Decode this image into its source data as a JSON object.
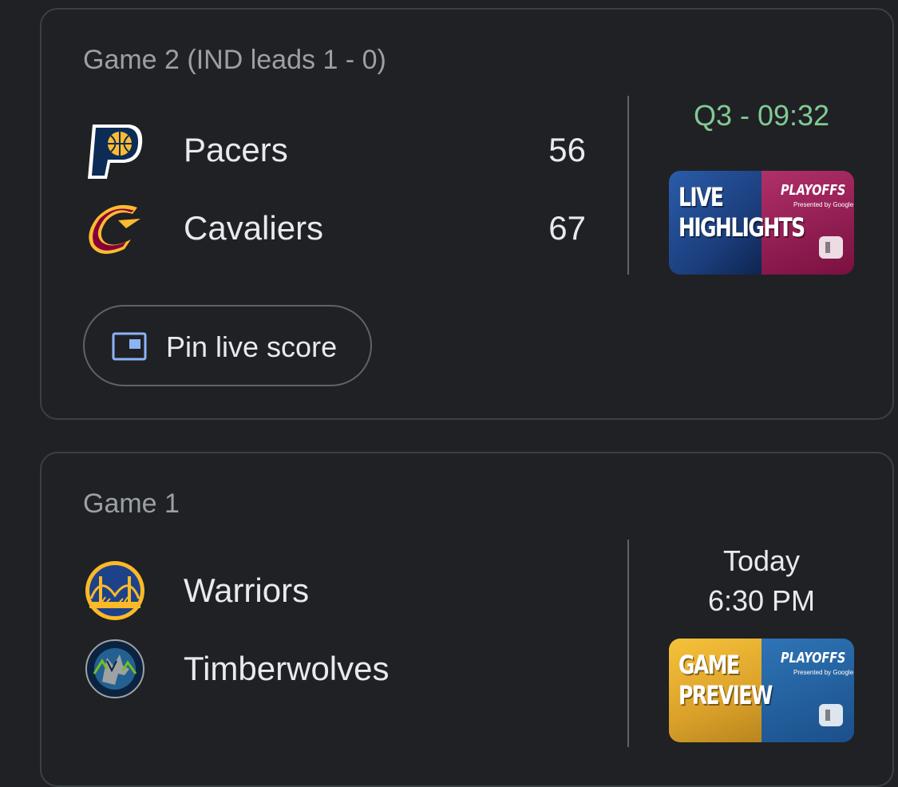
{
  "games": [
    {
      "title": "Game 2 (IND leads 1 - 0)",
      "teams": [
        {
          "name": "Pacers",
          "score": "56"
        },
        {
          "name": "Cavaliers",
          "score": "67"
        }
      ],
      "status": "Q3 - 09:32",
      "video": {
        "line1": "LIVE",
        "line2": "HIGHLIGHTS",
        "badge": "PLAYOFFS",
        "badge_sub": "Presented by Google"
      },
      "pin_button": {
        "label": "Pin live score"
      }
    },
    {
      "title": "Game 1",
      "teams": [
        {
          "name": "Warriors"
        },
        {
          "name": "Timberwolves"
        }
      ],
      "date": "Today",
      "time": "6:30 PM",
      "video": {
        "line1": "GAME",
        "line2": "PREVIEW",
        "badge": "PLAYOFFS",
        "badge_sub": "Presented by Google"
      }
    }
  ],
  "colors": {
    "background": "#202124",
    "card_border": "#3c4043",
    "live_status": "#81c995",
    "pin_icon": "#8ab4f8"
  }
}
